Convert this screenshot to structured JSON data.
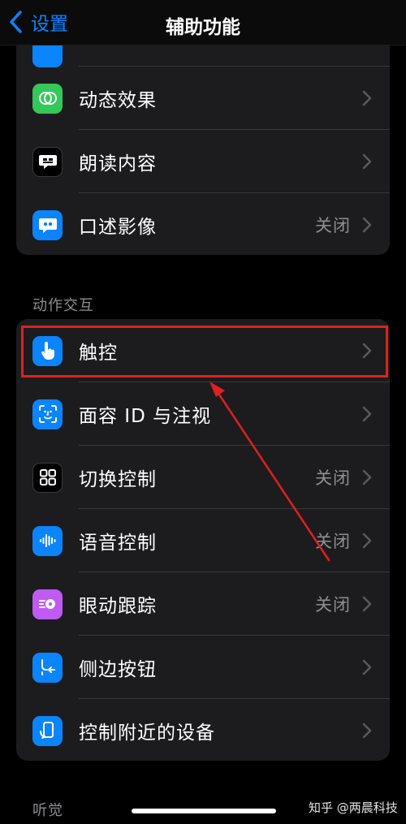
{
  "nav": {
    "back_label": "设置",
    "title": "辅助功能"
  },
  "vision_group": {
    "rows": [
      {
        "label": "动态效果",
        "value": "",
        "icon": "motion-icon",
        "color": "#34c759"
      },
      {
        "label": "朗读内容",
        "value": "",
        "icon": "speech-bubble-icon",
        "color": "#1c1c1e"
      },
      {
        "label": "口述影像",
        "value": "关闭",
        "icon": "quote-bubble-icon",
        "color": "#0a84ff"
      }
    ]
  },
  "interaction_section": {
    "header": "动作交互",
    "rows": [
      {
        "label": "触控",
        "value": "",
        "icon": "touch-hand-icon",
        "color": "#0a84ff"
      },
      {
        "label": "面容 ID 与注视",
        "value": "",
        "icon": "face-id-icon",
        "color": "#0a84ff"
      },
      {
        "label": "切换控制",
        "value": "关闭",
        "icon": "grid-icon",
        "color": "#1c1c1e"
      },
      {
        "label": "语音控制",
        "value": "关闭",
        "icon": "waveform-icon",
        "color": "#0a84ff"
      },
      {
        "label": "眼动跟踪",
        "value": "关闭",
        "icon": "eye-tracking-icon",
        "color": "#bf5af2"
      },
      {
        "label": "侧边按钮",
        "value": "",
        "icon": "side-button-icon",
        "color": "#0a84ff"
      },
      {
        "label": "控制附近的设备",
        "value": "",
        "icon": "nearby-device-icon",
        "color": "#0a84ff"
      }
    ]
  },
  "hearing_section": {
    "header": "听觉"
  },
  "watermark": "知乎 @两晨科技",
  "annotation": {
    "highlight_color": "#e02020"
  }
}
